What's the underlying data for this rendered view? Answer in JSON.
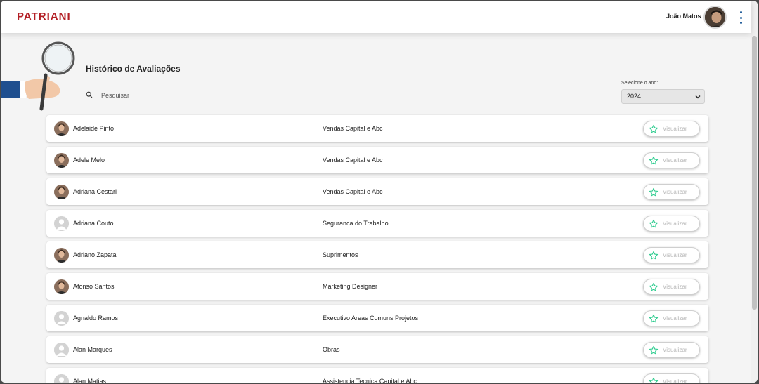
{
  "header": {
    "logo": "PATRIANI",
    "user_name": "João Matos",
    "brand_color": "#b31e24"
  },
  "page": {
    "title": "Histórico de Avaliações",
    "search": {
      "placeholder": "Pesquisar",
      "value": ""
    },
    "year_label": "Selecione o ano:",
    "year_value": "2024"
  },
  "colors": {
    "star": "#2ecc8f",
    "button_text": "#b8b8b8"
  },
  "rows": [
    {
      "name": "Adelaide Pinto",
      "department": "Vendas Capital e Abc",
      "button": "Visualizar",
      "photo": "photo"
    },
    {
      "name": "Adele Melo",
      "department": "Vendas Capital e Abc",
      "button": "Visualizar",
      "photo": "photo"
    },
    {
      "name": "Adriana Cestari",
      "department": "Vendas Capital e Abc",
      "button": "Visualizar",
      "photo": "photo"
    },
    {
      "name": "Adriana Couto",
      "department": "Seguranca do Trabalho",
      "button": "Visualizar",
      "photo": "placeholder"
    },
    {
      "name": "Adriano Zapata",
      "department": "Suprimentos",
      "button": "Visualizar",
      "photo": "photo"
    },
    {
      "name": "Afonso Santos",
      "department": "Marketing Designer",
      "button": "Visualizar",
      "photo": "photo"
    },
    {
      "name": "Agnaldo Ramos",
      "department": "Executivo Areas Comuns Projetos",
      "button": "Visualizar",
      "photo": "placeholder"
    },
    {
      "name": "Alan Marques",
      "department": "Obras",
      "button": "Visualizar",
      "photo": "placeholder"
    },
    {
      "name": "Alan Matias",
      "department": "Assistencia Tecnica Capital e Abc",
      "button": "Visualizar",
      "photo": "placeholder"
    }
  ]
}
